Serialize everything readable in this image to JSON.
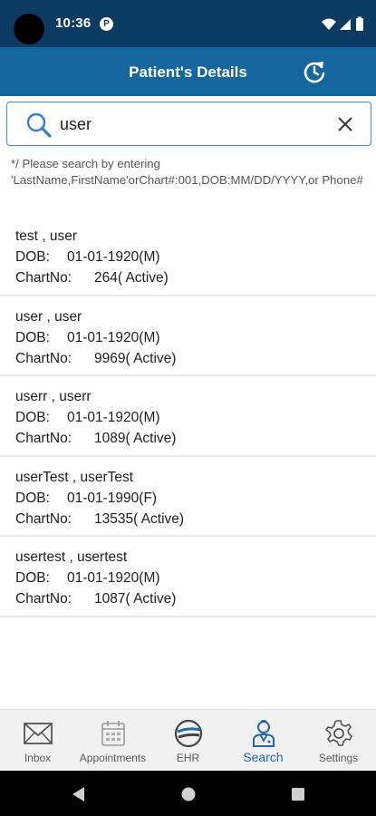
{
  "status_bar": {
    "time": "10:36",
    "app_notification_letter": "P"
  },
  "header": {
    "title": "Patient's Details"
  },
  "search": {
    "value": "user",
    "placeholder": ""
  },
  "hint": "*/ Please search by entering 'LastName,FirstName'orChart#:001,DOB:MM/DD/YYYY,or Phone#",
  "labels": {
    "dob": "DOB:",
    "chart": "ChartNo:"
  },
  "patients": [
    {
      "name": "test , user",
      "dob": "01-01-1920(M)",
      "chart": "264( Active)"
    },
    {
      "name": "user , user",
      "dob": "01-01-1920(M)",
      "chart": "9969( Active)"
    },
    {
      "name": "userr , userr",
      "dob": "01-01-1920(M)",
      "chart": "1089( Active)"
    },
    {
      "name": "userTest , userTest",
      "dob": "01-01-1990(F)",
      "chart": "13535( Active)"
    },
    {
      "name": "usertest , usertest",
      "dob": "01-01-1920(M)",
      "chart": "1087( Active)"
    }
  ],
  "nav": {
    "items": [
      {
        "label": "Inbox",
        "icon": "envelope-icon"
      },
      {
        "label": "Appointments",
        "icon": "calendar-icon"
      },
      {
        "label": "EHR",
        "icon": "ehr-logo-icon"
      },
      {
        "label": "Search",
        "icon": "doctor-icon",
        "active": true
      },
      {
        "label": "Settings",
        "icon": "gear-icon"
      }
    ]
  },
  "colors": {
    "status_bar": "#0b3b63",
    "app_bar": "#15659e",
    "accent": "#2a66ab"
  }
}
